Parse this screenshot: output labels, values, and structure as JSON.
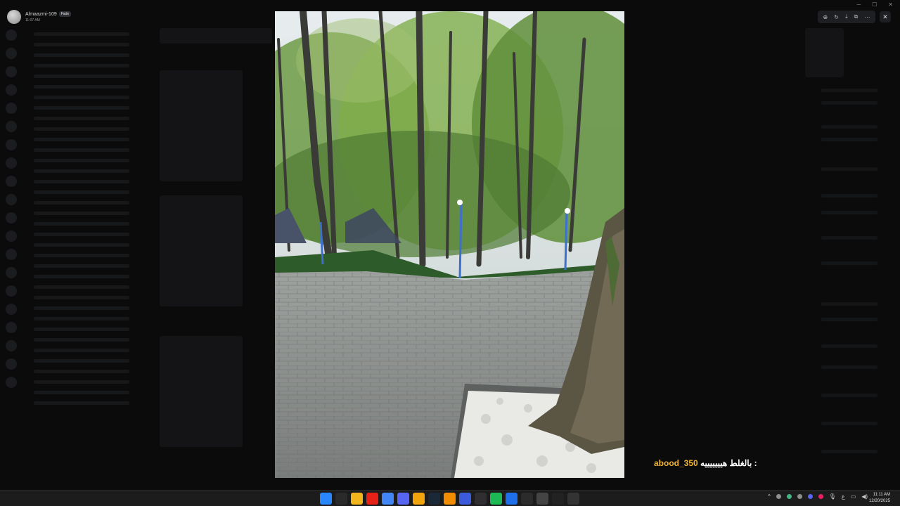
{
  "user": {
    "name": "Almaazmi-109",
    "badge": "Fade",
    "time": "11:07 AM"
  },
  "window_controls": {
    "minimize": "─",
    "maximize": "☐",
    "close": "✕"
  },
  "viewer_tools": [
    "zoom-in",
    "rotate",
    "download",
    "open-in-browser",
    "more"
  ],
  "caption": {
    "text": "بالغلط هيييييييه :",
    "username": "abood_350"
  },
  "taskbar": {
    "apps": [
      {
        "name": "start",
        "color": "#2a86ff"
      },
      {
        "name": "search",
        "color": "#2a2a2a"
      },
      {
        "name": "file-explorer",
        "color": "#f2b51d"
      },
      {
        "name": "youtube",
        "color": "#e62117"
      },
      {
        "name": "chrome",
        "color": "#4285f4"
      },
      {
        "name": "discord-canary",
        "color": "#5865f2"
      },
      {
        "name": "chrome-canary",
        "color": "#f1a40c"
      },
      {
        "name": "steam",
        "color": "#1b2838"
      },
      {
        "name": "vlc",
        "color": "#f28c00"
      },
      {
        "name": "app-blue",
        "color": "#3b5bdb"
      },
      {
        "name": "obs",
        "color": "#302e31"
      },
      {
        "name": "spotify",
        "color": "#1db954"
      },
      {
        "name": "app-edit",
        "color": "#1f6feb"
      },
      {
        "name": "terminal",
        "color": "#2b2b2b"
      },
      {
        "name": "app-notify",
        "color": "#444"
      },
      {
        "name": "capcut",
        "color": "#222"
      },
      {
        "name": "app-dark",
        "color": "#333"
      }
    ],
    "tray_lang": "ع",
    "clock_time": "11:11 AM",
    "clock_date": "12/20/2025"
  }
}
